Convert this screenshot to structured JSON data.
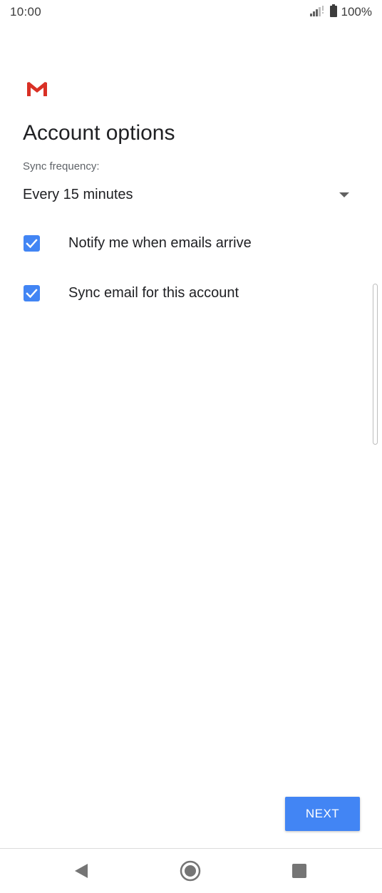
{
  "status_bar": {
    "time": "10:00",
    "battery_text": "100%"
  },
  "page": {
    "title": "Account options",
    "sync_frequency_label": "Sync frequency:",
    "sync_frequency_value": "Every 15 minutes"
  },
  "options": [
    {
      "label": "Notify me when emails arrive",
      "checked": true
    },
    {
      "label": "Sync email for this account",
      "checked": true
    }
  ],
  "actions": {
    "next_label": "NEXT"
  },
  "colors": {
    "accent": "#4285f4",
    "gmail_red": "#d93025"
  },
  "icons": {
    "logo": "gmail-icon",
    "signal": "signal-icon",
    "battery": "battery-icon",
    "back": "back-icon",
    "home": "home-icon",
    "recents": "recents-icon"
  }
}
